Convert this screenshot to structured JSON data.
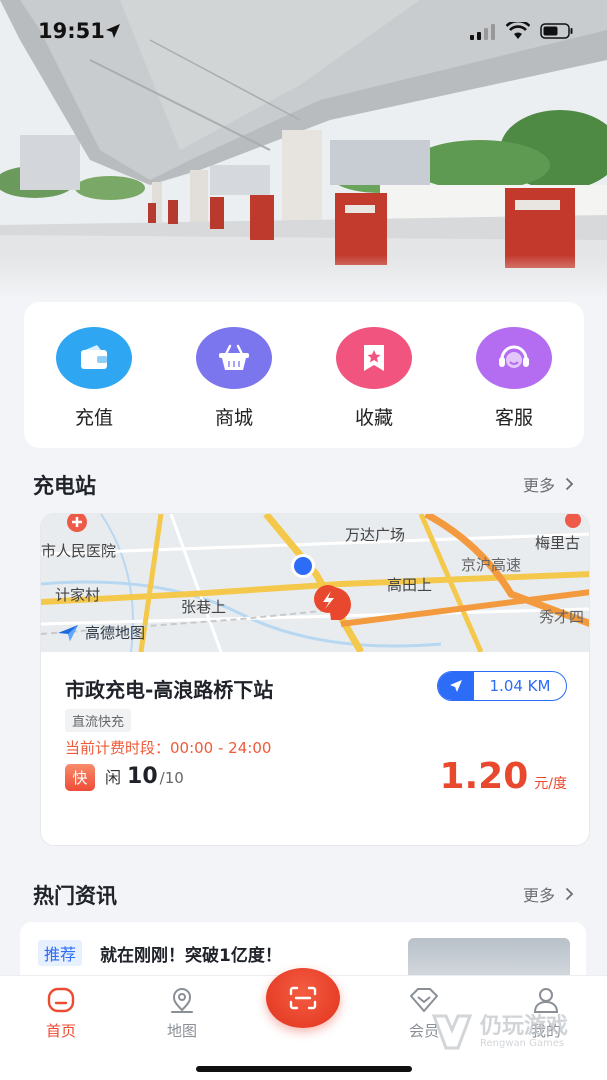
{
  "status_bar": {
    "time": "19:51"
  },
  "quick_menu": [
    {
      "label": "充值",
      "icon": "wallet-icon",
      "color": "#2ea6f2"
    },
    {
      "label": "商城",
      "icon": "basket-icon",
      "color": "#7b76ee"
    },
    {
      "label": "收藏",
      "icon": "favorite-icon",
      "color": "#f1557f"
    },
    {
      "label": "客服",
      "icon": "customer-service-icon",
      "color": "#b46cf0"
    }
  ],
  "stations_section": {
    "title": "充电站",
    "more": "更多"
  },
  "station": {
    "map_labels": [
      "市人民医院",
      "计家村",
      "张巷上",
      "高田上",
      "梅里古",
      "万达广场",
      "京沪高速",
      "秀才四"
    ],
    "map_provider": "高德地图",
    "name": "市政充电-高浪路桥下站",
    "distance": "1.04 KM",
    "charge_type": "直流快充",
    "tariff_period": "当前计费时段：00:00 - 24:00",
    "speed_badge": "快",
    "idle_label": "闲",
    "idle_free": "10",
    "idle_total": "/10",
    "price": "1.20",
    "price_unit": "元/度"
  },
  "news_section": {
    "title": "热门资讯",
    "more": "更多"
  },
  "news": [
    {
      "tag": "推荐",
      "title": "就在刚刚！突破1亿度！"
    }
  ],
  "tab_bar": [
    {
      "label": "首页",
      "icon": "home-icon",
      "active": true
    },
    {
      "label": "地图",
      "icon": "map-pin-icon",
      "active": false
    },
    {
      "label": "会员",
      "icon": "member-icon",
      "active": false
    },
    {
      "label": "我的",
      "icon": "profile-icon",
      "active": false
    }
  ],
  "accent_color": "#ec4b32",
  "watermark": {
    "text": "仍玩游戏",
    "sub": "Rengwan Games"
  }
}
